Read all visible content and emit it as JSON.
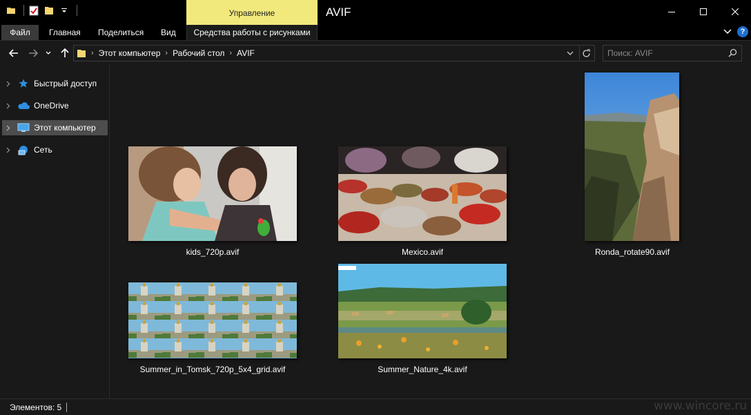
{
  "window": {
    "title": "AVIF",
    "context_tab": "Управление"
  },
  "ribbon": {
    "tabs": [
      {
        "label": "Файл"
      },
      {
        "label": "Главная"
      },
      {
        "label": "Поделиться"
      },
      {
        "label": "Вид"
      },
      {
        "label": "Средства работы с рисунками"
      }
    ]
  },
  "address": {
    "breadcrumbs": [
      "Этот компьютер",
      "Рабочий стол",
      "AVIF"
    ]
  },
  "search": {
    "placeholder": "Поиск: AVIF"
  },
  "sidebar": {
    "items": [
      {
        "label": "Быстрый доступ",
        "icon": "star-icon"
      },
      {
        "label": "OneDrive",
        "icon": "cloud-icon"
      },
      {
        "label": "Этот компьютер",
        "icon": "computer-icon",
        "selected": true
      },
      {
        "label": "Сеть",
        "icon": "network-icon"
      }
    ]
  },
  "files": [
    {
      "name": "kids_720p.avif"
    },
    {
      "name": "Mexico.avif"
    },
    {
      "name": "Ronda_rotate90.avif"
    },
    {
      "name": "Summer_in_Tomsk_720p_5x4_grid.avif"
    },
    {
      "name": "Summer_Nature_4k.avif"
    }
  ],
  "status": {
    "items_count": "Элементов: 5"
  },
  "watermark": "www.wincore.ru",
  "colors": {
    "accent_tab": "#f2e97c",
    "background": "#191919",
    "titlebar": "#000000",
    "selected_item": "#4d4d4d"
  }
}
